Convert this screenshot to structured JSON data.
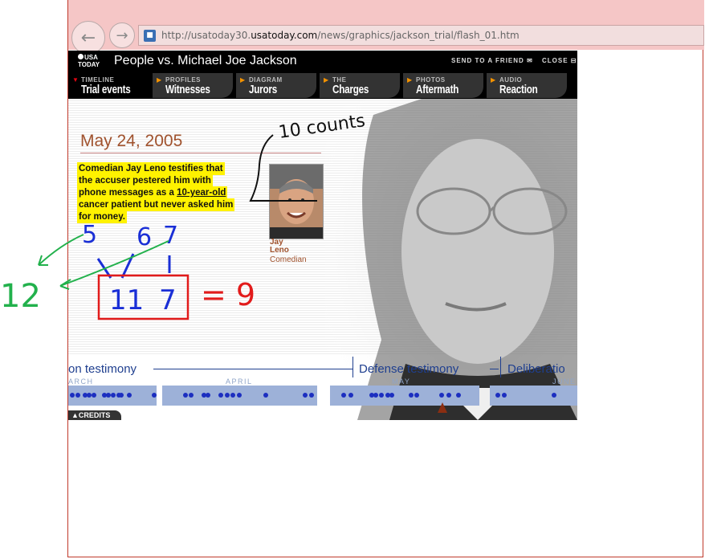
{
  "browser": {
    "url_prefix": "http://usatoday30.",
    "url_domain": "usatoday.com",
    "url_path": "/news/graphics/jackson_trial/flash_01.htm",
    "back_icon": "arrow-left-icon",
    "forward_icon": "arrow-right-icon"
  },
  "header": {
    "logo_text": "USA TODAY",
    "title": "People vs. Michael Joe Jackson",
    "send_to_friend": "SEND TO A FRIEND",
    "close": "CLOSE"
  },
  "tabs": [
    {
      "sub": "TIMELINE",
      "label": "Trial events",
      "active": true
    },
    {
      "sub": "PROFILES",
      "label": "Witnesses"
    },
    {
      "sub": "DIAGRAM",
      "label": "Jurors"
    },
    {
      "sub": "THE",
      "label": "Charges"
    },
    {
      "sub": "PHOTOS",
      "label": "Aftermath"
    },
    {
      "sub": "AUDIO",
      "label": "Reaction"
    }
  ],
  "event": {
    "date": "May 24, 2005",
    "summary_1": "Comedian Jay Leno testifies that",
    "summary_2": "the accuser pestered him with",
    "summary_3a": "phone messages as a ",
    "summary_3b": "10-year-old",
    "summary_4": "cancer patient but never asked him",
    "summary_5": "for money.",
    "witness_first": "Jay",
    "witness_last": "Leno",
    "witness_role": "Comedian"
  },
  "timeline": {
    "phase_1": "on testimony",
    "phase_2": "Defense testimony",
    "phase_3": "Deliberatio",
    "months": [
      "ARCH",
      "APRIL",
      "MAY",
      "JUNE"
    ],
    "credits": "▲CREDITS"
  },
  "annotations": {
    "note_counts": "10 counts",
    "n5": "5",
    "n6": "6",
    "n7": "7",
    "n12": "12",
    "box_left": "11",
    "box_right": "7",
    "result": "= 9",
    "ink_black": "#111111",
    "ink_blue": "#1a2fd6",
    "ink_green": "#22b14c",
    "ink_red": "#e21b1b"
  },
  "colors": {
    "highlight": "#fff200",
    "date": "#a0522d",
    "timeline_blue": "#1f3f8f",
    "tab_arrow": "#f39200"
  }
}
